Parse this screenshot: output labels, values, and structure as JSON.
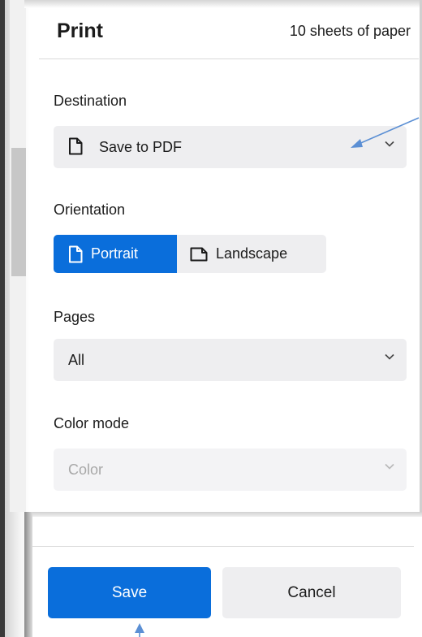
{
  "header": {
    "title": "Print",
    "sheet_count": "10 sheets of paper"
  },
  "destination": {
    "label": "Destination",
    "value": "Save to PDF",
    "icon": "document-icon"
  },
  "orientation": {
    "label": "Orientation",
    "options": [
      {
        "label": "Portrait",
        "selected": true
      },
      {
        "label": "Landscape",
        "selected": false
      }
    ]
  },
  "pages": {
    "label": "Pages",
    "value": "All"
  },
  "color_mode": {
    "label": "Color mode",
    "value": "Color",
    "disabled": true
  },
  "footer": {
    "save_label": "Save",
    "cancel_label": "Cancel"
  },
  "colors": {
    "accent": "#0a6edb",
    "annotation_arrow": "#5b8fd4"
  }
}
